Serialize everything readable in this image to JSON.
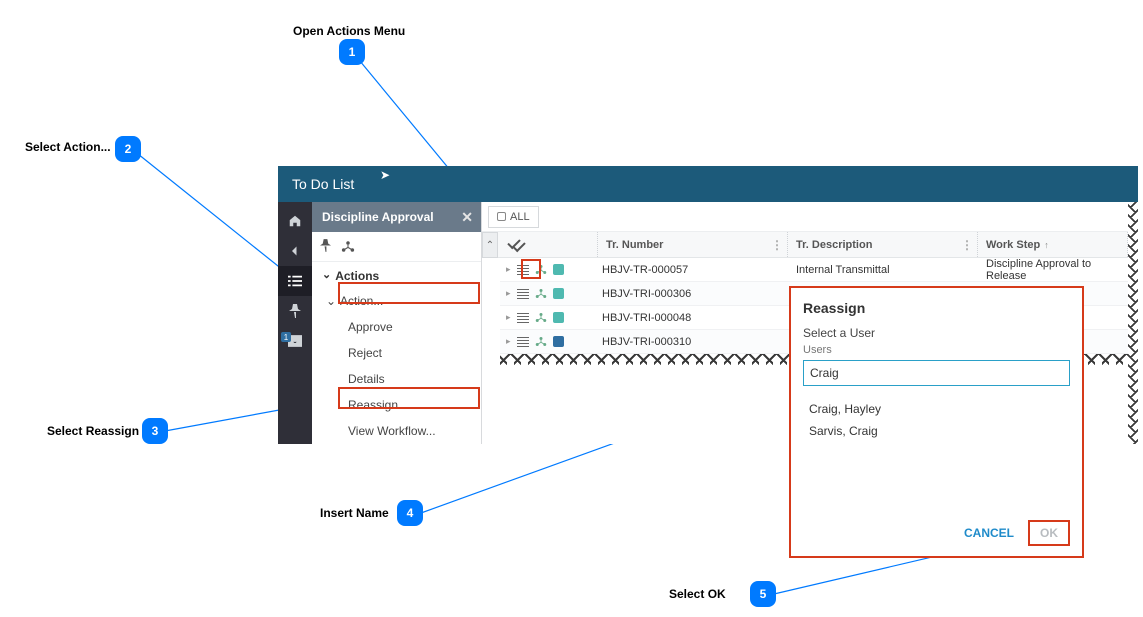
{
  "callouts": {
    "c1": {
      "label": "Open Actions Menu",
      "num": "1"
    },
    "c2": {
      "label": "Select Action...",
      "num": "2"
    },
    "c3": {
      "label": "Select Reassign",
      "num": "3"
    },
    "c4": {
      "label": "Insert Name",
      "num": "4"
    },
    "c5": {
      "label": "Select OK",
      "num": "5"
    }
  },
  "window": {
    "title": "To Do List"
  },
  "iconbar": {
    "pin_badge": "1"
  },
  "sidepanel": {
    "title": "Discipline Approval",
    "actions_header": "Actions",
    "items": {
      "action": "Action...",
      "approve": "Approve",
      "reject": "Reject",
      "details": "Details",
      "reassign": "Reassign",
      "view_workflow": "View Workflow..."
    }
  },
  "toolbar": {
    "all": "ALL"
  },
  "grid": {
    "headers": {
      "tr_number": "Tr. Number",
      "tr_description": "Tr. Description",
      "work_step": "Work Step"
    },
    "rows": [
      {
        "num": "HBJV-TR-000057",
        "desc": "Internal Transmittal",
        "ws": "Discipline Approval to Release",
        "color": "#4fb9b0"
      },
      {
        "num": "HBJV-TRI-000306",
        "desc": "",
        "ws": "",
        "color": "#4fb9b0"
      },
      {
        "num": "HBJV-TRI-000048",
        "desc": "",
        "ws": "",
        "color": "#4fb9b0"
      },
      {
        "num": "HBJV-TRI-000310",
        "desc": "",
        "ws": "",
        "color": "#2f6ea1"
      }
    ]
  },
  "dialog": {
    "title": "Reassign",
    "select_user": "Select a User",
    "users_label": "Users",
    "input_value": "Craig",
    "options": [
      "Craig, Hayley",
      "Sarvis, Craig"
    ],
    "cancel": "CANCEL",
    "ok": "OK"
  }
}
